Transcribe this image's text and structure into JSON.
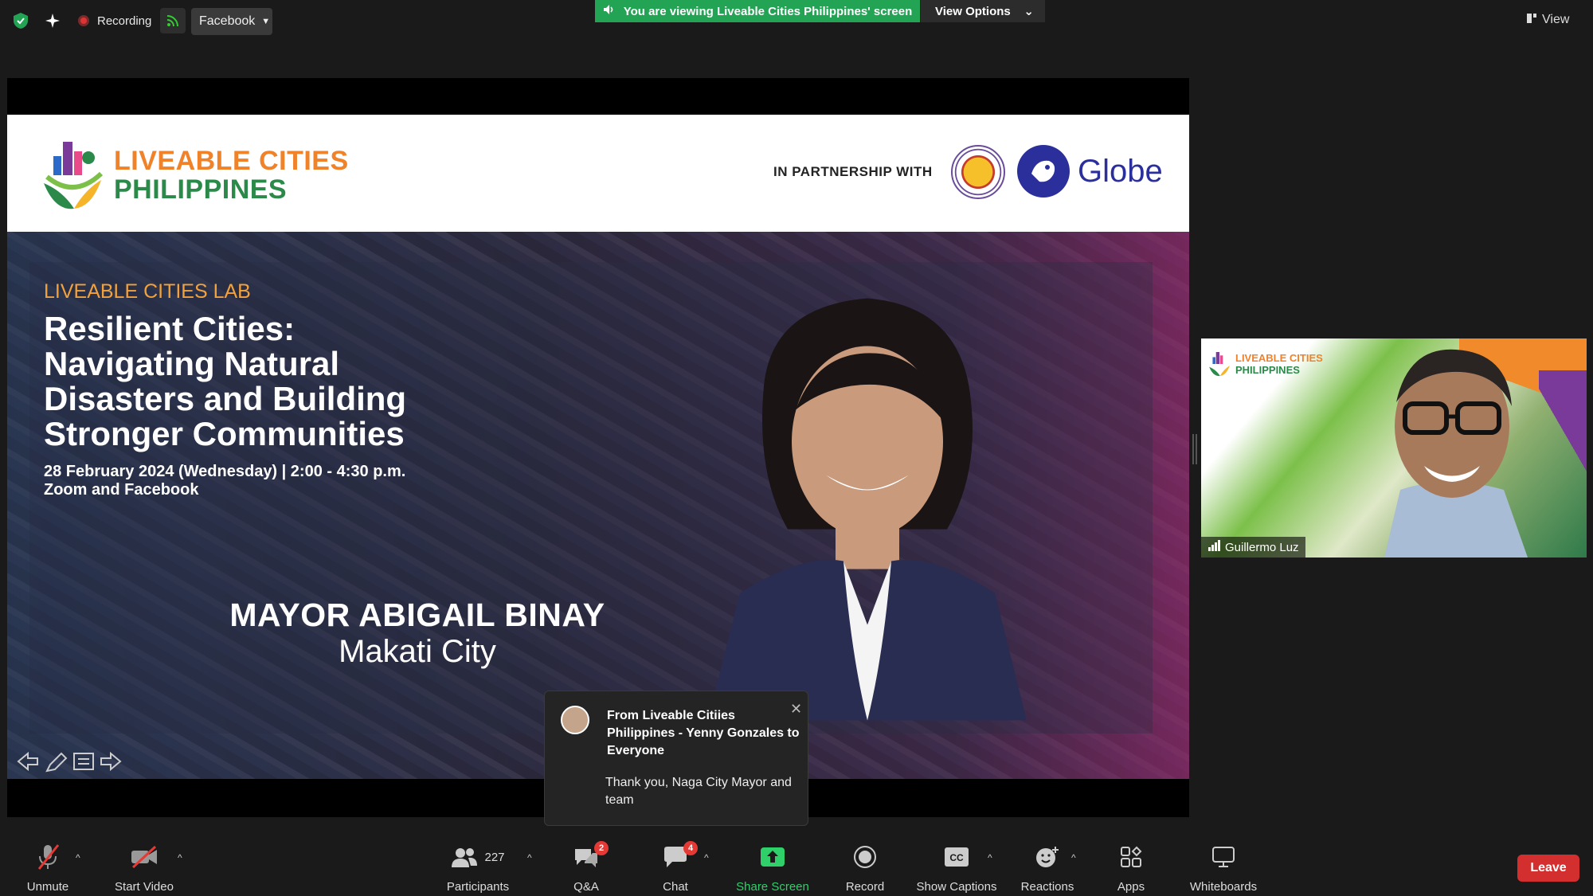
{
  "topbar": {
    "recording_label": "Recording",
    "stream_target": "Facebook",
    "viewing_banner": "You are viewing Liveable Cities Philippines' screen",
    "view_options_label": "View Options",
    "view_label": "View"
  },
  "slide": {
    "logo_line1": "LIVEABLE CITIES",
    "logo_line2": "PHILIPPINES",
    "partnership_label": "IN PARTNERSHIP WITH",
    "partner_name": "Globe",
    "lab_title": "LIVEABLE CITIES LAB",
    "title_line1": "Resilient Cities:",
    "title_line2": "Navigating Natural",
    "title_line3": "Disasters and Building",
    "title_line4": "Stronger Communities",
    "date_line": "28 February 2024 (Wednesday) | 2:00 - 4:30 p.m.",
    "platform_line": "Zoom and Facebook",
    "speaker_name": "MAYOR ABIGAIL BINAY",
    "speaker_city": "Makati City"
  },
  "chat_toast": {
    "from": "From Liveable Citiies Philippines - Yenny Gonzales to Everyone",
    "message": "Thank you, Naga City Mayor and team"
  },
  "participant_video": {
    "logo_line1": "LIVEABLE CITIES",
    "logo_line2": "PHILIPPINES",
    "name": "Guillermo Luz"
  },
  "toolbar": {
    "unmute": "Unmute",
    "start_video": "Start Video",
    "participants": "Participants",
    "participants_count": "227",
    "qa": "Q&A",
    "qa_badge": "2",
    "chat": "Chat",
    "chat_badge": "4",
    "share_screen": "Share Screen",
    "record": "Record",
    "show_captions": "Show Captions",
    "reactions": "Reactions",
    "apps": "Apps",
    "whiteboards": "Whiteboards",
    "leave": "Leave"
  },
  "colors": {
    "brand_orange": "#f0822a",
    "brand_green": "#2b8a4a",
    "zoom_green": "#23a455",
    "globe_blue": "#2b2f9b",
    "leave_red": "#d32f2f"
  }
}
